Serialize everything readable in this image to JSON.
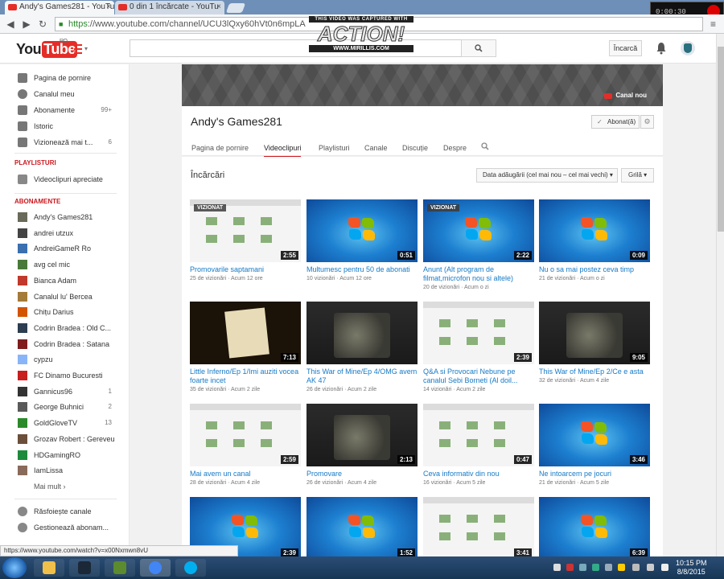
{
  "browser": {
    "tabs": [
      {
        "label": "Andy's Games281 - YouTu",
        "close": "×"
      },
      {
        "label": "0 din 1 încărcate - YouTu",
        "close": "×"
      }
    ],
    "url_scheme": "https",
    "url_rest": "://www.youtube.com/channel/UCU3lQxy60hVt0n6mpLA",
    "status_url": "https://www.youtube.com/watch?v=x00Nxmwn8vU",
    "recorder_time": "0:00:30"
  },
  "watermark": {
    "top": "THIS VIDEO WAS CAPTURED WITH",
    "main": "ACTION!",
    "bottom": "WWW.MIRILLIS.COM"
  },
  "header": {
    "logo_you": "You",
    "logo_tube": "Tube",
    "logo_region": "RO",
    "upload_label": "Încarcă",
    "colors": {
      "brand": "#e52d27",
      "link": "#167ac6",
      "section": "#cc181e"
    }
  },
  "sidebar": {
    "main_items": [
      {
        "label": "Pagina de pornire",
        "icon": "home-icon",
        "count": ""
      },
      {
        "label": "Canalul meu",
        "icon": "user-icon",
        "count": ""
      },
      {
        "label": "Abonamente",
        "icon": "subscriptions-icon",
        "count": "99+"
      },
      {
        "label": "Istoric",
        "icon": "history-icon",
        "count": ""
      },
      {
        "label": "Vizionează mai t...",
        "icon": "clock-icon",
        "count": "6"
      }
    ],
    "playlists_title": "PLAYLISTURI",
    "playlist_items": [
      {
        "label": "Videoclipuri apreciate",
        "icon": "thumbs-up-icon"
      }
    ],
    "subscriptions_title": "ABONAMENTE",
    "subscriptions": [
      {
        "label": "Andy's Games281",
        "count": "",
        "color": "#6a6a5a"
      },
      {
        "label": "andrei utzux",
        "count": "",
        "color": "#444"
      },
      {
        "label": "AndreiGameR Ro",
        "count": "",
        "color": "#3a6fb0"
      },
      {
        "label": "avg cel mic",
        "count": "",
        "color": "#4a7a3a"
      },
      {
        "label": "Bianca Adam",
        "count": "",
        "color": "#c0392b"
      },
      {
        "label": "Canalul lu' Bercea",
        "count": "",
        "color": "#a57b3a"
      },
      {
        "label": "Chițu Darius",
        "count": "",
        "color": "#d35400"
      },
      {
        "label": "Codrin Bradea : Old C...",
        "count": "",
        "color": "#2c3e50"
      },
      {
        "label": "Codrin Bradea : Satana",
        "count": "",
        "color": "#7f1d1d"
      },
      {
        "label": "cypzu",
        "count": "",
        "color": "#8ab4f8"
      },
      {
        "label": "FC Dinamo Bucuresti",
        "count": "",
        "color": "#c81e1e"
      },
      {
        "label": "Gannicus96",
        "count": "1",
        "color": "#333"
      },
      {
        "label": "George Buhnici",
        "count": "2",
        "color": "#5a5a5a"
      },
      {
        "label": "GoldGloveTV",
        "count": "13",
        "color": "#2a8a2a"
      },
      {
        "label": "Grozav Robert : Gereveu",
        "count": "",
        "color": "#6b4f3a"
      },
      {
        "label": "HDGamingRO",
        "count": "",
        "color": "#1e8a3c"
      },
      {
        "label": "IamLissa",
        "count": "",
        "color": "#8a6a5a"
      }
    ],
    "more_label": "Mai mult ›",
    "bottom_items": [
      {
        "label": "Răsfoiește canale",
        "icon": "browse-channels-icon"
      },
      {
        "label": "Gestionează abonam...",
        "icon": "manage-icon"
      }
    ]
  },
  "channel": {
    "title": "Andy's Games281",
    "new_channel_label": "Canal nou",
    "subscribe_label": "Abonat(ă)",
    "tabs": [
      {
        "label": "Pagina de pornire",
        "active": false
      },
      {
        "label": "Videoclipuri",
        "active": true
      },
      {
        "label": "Playlisturi",
        "active": false
      },
      {
        "label": "Canale",
        "active": false
      },
      {
        "label": "Discuție",
        "active": false
      },
      {
        "label": "Despre",
        "active": false
      }
    ]
  },
  "uploads": {
    "title": "Încărcări",
    "sort_label": "Data adăugării (cel mai nou – cel mai vechi)",
    "grid_label": "Grilă",
    "videos": [
      {
        "title": "Promovarile saptamani",
        "views": "25 de vizionări",
        "age": "Acum 12 ore",
        "duration": "2:55",
        "watched": "VIZIONAT",
        "style": "screen"
      },
      {
        "title": "Multumesc pentru 50 de abonati",
        "views": "10 vizionări",
        "age": "Acum 12 ore",
        "duration": "0:51",
        "watched": "",
        "style": "win"
      },
      {
        "title": "Anunt (Alt program de filmat,microfon nou si altele)",
        "views": "20 de vizionări",
        "age": "Acum o zi",
        "duration": "2:22",
        "watched": "VIZIONAT",
        "style": "win"
      },
      {
        "title": "Nu o sa mai postez ceva timp",
        "views": "21 de vizionări",
        "age": "Acum o zi",
        "duration": "0:09",
        "watched": "",
        "style": "win"
      },
      {
        "title": "Little Inferno/Ep 1/Imi auziti vocea foarte incet",
        "views": "35 de vizionări",
        "age": "Acum 2 zile",
        "duration": "7:13",
        "watched": "",
        "style": "inferno"
      },
      {
        "title": "This War of Mine/Ep 4/OMG avem AK 47",
        "views": "26 de vizionări",
        "age": "Acum 2 zile",
        "duration": "",
        "watched": "",
        "style": "dark"
      },
      {
        "title": "Q&A si Provocari Nebune pe canalul Sebi Borneti (Al doil...",
        "views": "14 vizionări",
        "age": "Acum 2 zile",
        "duration": "2:39",
        "watched": "",
        "style": "screen"
      },
      {
        "title": "This War of Mine/Ep 2/Ce e asta",
        "views": "32 de vizionări",
        "age": "Acum 4 zile",
        "duration": "9:05",
        "watched": "",
        "style": "dark"
      },
      {
        "title": "Mai avem un canal",
        "views": "28 de vizionări",
        "age": "Acum 4 zile",
        "duration": "2:59",
        "watched": "",
        "style": "screen"
      },
      {
        "title": "Promovare",
        "views": "26 de vizionări",
        "age": "Acum 4 zile",
        "duration": "2:13",
        "watched": "",
        "style": "dark"
      },
      {
        "title": "Ceva informativ din nou",
        "views": "16 vizionări",
        "age": "Acum 5 zile",
        "duration": "0:47",
        "watched": "",
        "style": "screen"
      },
      {
        "title": "Ne intoarcem pe jocuri",
        "views": "21 de vizionări",
        "age": "Acum 5 zile",
        "duration": "3:46",
        "watched": "",
        "style": "win"
      },
      {
        "title": "",
        "views": "",
        "age": "",
        "duration": "2:39",
        "watched": "",
        "style": "win"
      },
      {
        "title": "",
        "views": "",
        "age": "",
        "duration": "1:52",
        "watched": "",
        "style": "win"
      },
      {
        "title": "",
        "views": "",
        "age": "",
        "duration": "3:41",
        "watched": "",
        "style": "screen"
      },
      {
        "title": "",
        "views": "",
        "age": "",
        "duration": "6:39",
        "watched": "",
        "style": "win"
      }
    ]
  },
  "taskbar": {
    "time": "10:15 PM",
    "date": "8/8/2015",
    "apps": [
      "explorer",
      "steam",
      "minecraft",
      "chrome",
      "skype"
    ]
  }
}
